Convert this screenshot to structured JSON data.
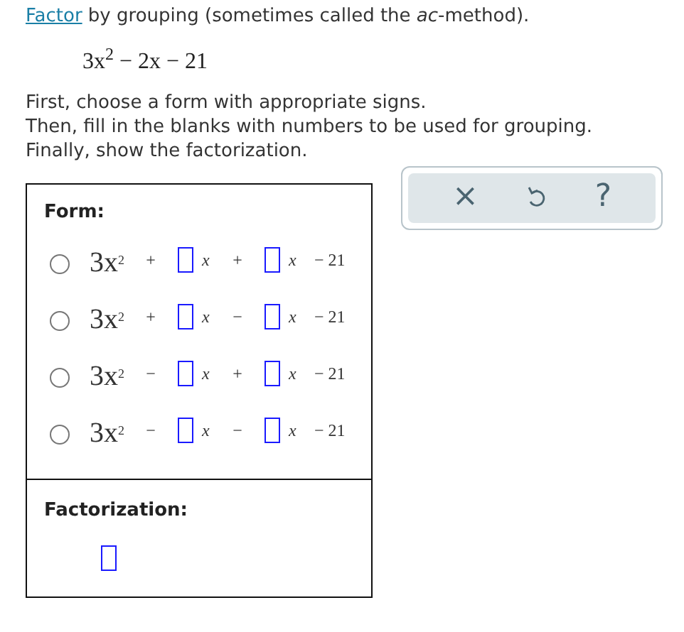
{
  "intro": {
    "link": "Factor",
    "text": "by grouping (sometimes called the *ac*-method)."
  },
  "expression": "3x$^{2}$ − 2x − 21",
  "instructions": [
    "First, choose a form with appropriate signs.",
    "Then, fill in the blanks with numbers to be used for grouping.",
    "Finally, show the factorization."
  ],
  "form": {
    "label": "Form:",
    "options": [
      {
        "selected": false,
        "lead": "3x$^{2}$",
        "op1": "+",
        "var1": "x",
        "op2": "+",
        "var2": "x",
        "tail": "− 21"
      },
      {
        "selected": false,
        "lead": "3x$^{2}$",
        "op1": "+",
        "var1": "x",
        "op2": "−",
        "var2": "x",
        "tail": "− 21"
      },
      {
        "selected": false,
        "lead": "3x$^{2}$",
        "op1": "−",
        "var1": "x",
        "op2": "+",
        "var2": "x",
        "tail": "− 21"
      },
      {
        "selected": false,
        "lead": "3x$^{2}$",
        "op1": "−",
        "var1": "x",
        "op2": "−",
        "var2": "x",
        "tail": "− 21"
      }
    ]
  },
  "factorization": {
    "label": "Factorization:"
  },
  "toolbar": [
    {
      "kind": "clear",
      "glyph": "×"
    },
    {
      "kind": "undo"
    },
    {
      "kind": "help",
      "glyph": "?"
    }
  ]
}
